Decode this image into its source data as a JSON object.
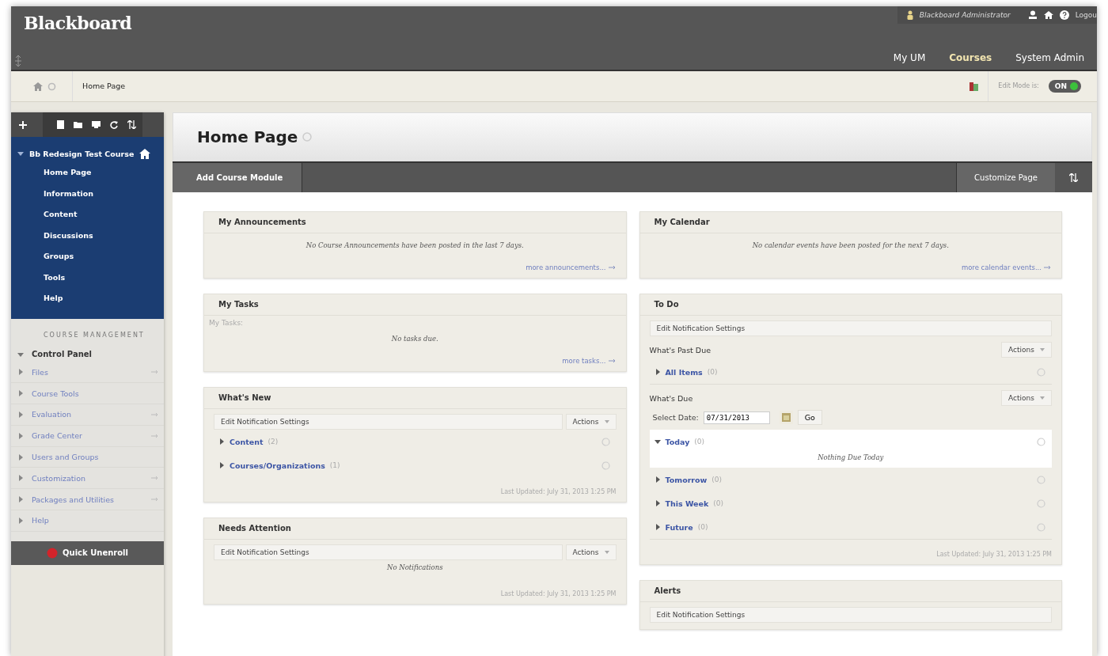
{
  "header": {
    "logo": "Blackboard",
    "user": "Blackboard Administrator",
    "logout": "Logou",
    "tabs": [
      {
        "label": "My UM",
        "selected": false
      },
      {
        "label": "Courses",
        "selected": true
      },
      {
        "label": "System Admin",
        "selected": false
      }
    ]
  },
  "breadcrumb": {
    "current": "Home Page",
    "edit_mode_label": "Edit Mode is:",
    "edit_mode": {
      "text": "ON",
      "on": true
    }
  },
  "sidebar": {
    "course": {
      "title": "Bb Redesign Test Course",
      "expanded": true,
      "items": [
        "Home Page",
        "Information",
        "Content",
        "Discussions",
        "Groups",
        "Tools",
        "Help"
      ]
    },
    "management": {
      "heading": "COURSE MANAGEMENT",
      "control_panel": {
        "label": "Control Panel",
        "expanded": true,
        "children": [
          {
            "label": "Files",
            "expanded": false,
            "quick_link": true
          },
          {
            "label": "Course Tools",
            "expanded": false,
            "quick_link": false
          },
          {
            "label": "Evaluation",
            "expanded": false,
            "quick_link": true
          },
          {
            "label": "Grade Center",
            "expanded": false,
            "quick_link": true
          },
          {
            "label": "Users and Groups",
            "expanded": false,
            "quick_link": false
          },
          {
            "label": "Customization",
            "expanded": false,
            "quick_link": true
          },
          {
            "label": "Packages and Utilities",
            "expanded": false,
            "quick_link": true
          },
          {
            "label": "Help",
            "expanded": false,
            "quick_link": false
          }
        ]
      }
    },
    "quick_unenroll": "Quick Unenroll"
  },
  "page": {
    "title": "Home Page",
    "add_module": "Add Course Module",
    "customize": "Customize Page",
    "columns": [
      [
        {
          "title": "My Announcements",
          "message": "No Course Announcements have been posted in the last 7 days.",
          "link": "more announcements..."
        },
        {
          "title": "My Tasks",
          "label": "My Tasks:",
          "message": "No tasks due.",
          "link": "more tasks..."
        },
        {
          "title": "What's New",
          "settings": "Edit Notification Settings",
          "actions": "Actions",
          "groups": [
            {
              "label": "Content",
              "count": "(2)",
              "expanded": false
            },
            {
              "label": "Courses/Organizations",
              "count": "(1)",
              "expanded": false
            }
          ],
          "updated": "Last Updated: July 31, 2013 1:25 PM"
        },
        {
          "title": "Needs Attention",
          "settings": "Edit Notification Settings",
          "actions": "Actions",
          "message": "No Notifications",
          "updated": "Last Updated: July 31, 2013 1:25 PM"
        }
      ],
      [
        {
          "title": "My Calendar",
          "message": "No calendar events have been posted for the next 7 days.",
          "link": "more calendar events..."
        },
        {
          "title": "To Do",
          "settings": "Edit Notification Settings",
          "sections": [
            {
              "heading": "What's Past Due",
              "actions": "Actions",
              "groups": [
                {
                  "label": "All Items",
                  "count": "(0)",
                  "expanded": false
                }
              ]
            },
            {
              "heading": "What's Due",
              "actions": "Actions",
              "date_label": "Select Date:",
              "date": "07/31/2013",
              "go": "Go",
              "groups": [
                {
                  "label": "Today",
                  "count": "(0)",
                  "expanded": true,
                  "message": "Nothing Due Today"
                },
                {
                  "label": "Tomorrow",
                  "count": "(0)",
                  "expanded": false
                },
                {
                  "label": "This Week",
                  "count": "(0)",
                  "expanded": false
                },
                {
                  "label": "Future",
                  "count": "(0)",
                  "expanded": false
                }
              ]
            }
          ],
          "updated": "Last Updated: July 31, 2013 1:25 PM"
        },
        {
          "title": "Alerts",
          "settings": "Edit Notification Settings"
        }
      ]
    ]
  }
}
